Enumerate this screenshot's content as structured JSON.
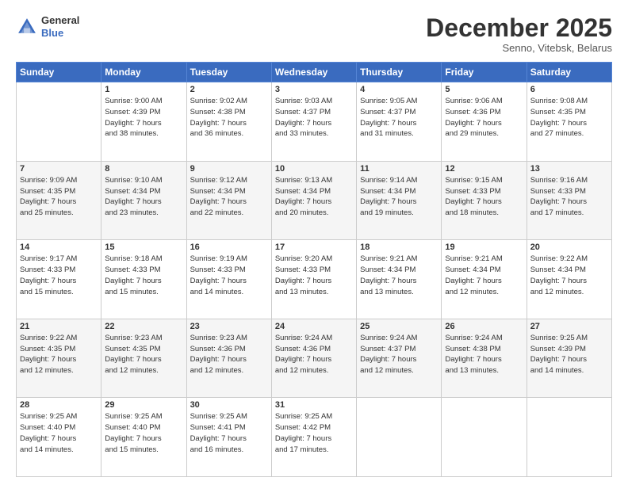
{
  "header": {
    "logo_line1": "General",
    "logo_line2": "Blue",
    "month_title": "December 2025",
    "location": "Senno, Vitebsk, Belarus"
  },
  "days_of_week": [
    "Sunday",
    "Monday",
    "Tuesday",
    "Wednesday",
    "Thursday",
    "Friday",
    "Saturday"
  ],
  "weeks": [
    [
      {
        "day": "",
        "info": ""
      },
      {
        "day": "1",
        "info": "Sunrise: 9:00 AM\nSunset: 4:39 PM\nDaylight: 7 hours\nand 38 minutes."
      },
      {
        "day": "2",
        "info": "Sunrise: 9:02 AM\nSunset: 4:38 PM\nDaylight: 7 hours\nand 36 minutes."
      },
      {
        "day": "3",
        "info": "Sunrise: 9:03 AM\nSunset: 4:37 PM\nDaylight: 7 hours\nand 33 minutes."
      },
      {
        "day": "4",
        "info": "Sunrise: 9:05 AM\nSunset: 4:37 PM\nDaylight: 7 hours\nand 31 minutes."
      },
      {
        "day": "5",
        "info": "Sunrise: 9:06 AM\nSunset: 4:36 PM\nDaylight: 7 hours\nand 29 minutes."
      },
      {
        "day": "6",
        "info": "Sunrise: 9:08 AM\nSunset: 4:35 PM\nDaylight: 7 hours\nand 27 minutes."
      }
    ],
    [
      {
        "day": "7",
        "info": "Sunrise: 9:09 AM\nSunset: 4:35 PM\nDaylight: 7 hours\nand 25 minutes."
      },
      {
        "day": "8",
        "info": "Sunrise: 9:10 AM\nSunset: 4:34 PM\nDaylight: 7 hours\nand 23 minutes."
      },
      {
        "day": "9",
        "info": "Sunrise: 9:12 AM\nSunset: 4:34 PM\nDaylight: 7 hours\nand 22 minutes."
      },
      {
        "day": "10",
        "info": "Sunrise: 9:13 AM\nSunset: 4:34 PM\nDaylight: 7 hours\nand 20 minutes."
      },
      {
        "day": "11",
        "info": "Sunrise: 9:14 AM\nSunset: 4:34 PM\nDaylight: 7 hours\nand 19 minutes."
      },
      {
        "day": "12",
        "info": "Sunrise: 9:15 AM\nSunset: 4:33 PM\nDaylight: 7 hours\nand 18 minutes."
      },
      {
        "day": "13",
        "info": "Sunrise: 9:16 AM\nSunset: 4:33 PM\nDaylight: 7 hours\nand 17 minutes."
      }
    ],
    [
      {
        "day": "14",
        "info": "Sunrise: 9:17 AM\nSunset: 4:33 PM\nDaylight: 7 hours\nand 15 minutes."
      },
      {
        "day": "15",
        "info": "Sunrise: 9:18 AM\nSunset: 4:33 PM\nDaylight: 7 hours\nand 15 minutes."
      },
      {
        "day": "16",
        "info": "Sunrise: 9:19 AM\nSunset: 4:33 PM\nDaylight: 7 hours\nand 14 minutes."
      },
      {
        "day": "17",
        "info": "Sunrise: 9:20 AM\nSunset: 4:33 PM\nDaylight: 7 hours\nand 13 minutes."
      },
      {
        "day": "18",
        "info": "Sunrise: 9:21 AM\nSunset: 4:34 PM\nDaylight: 7 hours\nand 13 minutes."
      },
      {
        "day": "19",
        "info": "Sunrise: 9:21 AM\nSunset: 4:34 PM\nDaylight: 7 hours\nand 12 minutes."
      },
      {
        "day": "20",
        "info": "Sunrise: 9:22 AM\nSunset: 4:34 PM\nDaylight: 7 hours\nand 12 minutes."
      }
    ],
    [
      {
        "day": "21",
        "info": "Sunrise: 9:22 AM\nSunset: 4:35 PM\nDaylight: 7 hours\nand 12 minutes."
      },
      {
        "day": "22",
        "info": "Sunrise: 9:23 AM\nSunset: 4:35 PM\nDaylight: 7 hours\nand 12 minutes."
      },
      {
        "day": "23",
        "info": "Sunrise: 9:23 AM\nSunset: 4:36 PM\nDaylight: 7 hours\nand 12 minutes."
      },
      {
        "day": "24",
        "info": "Sunrise: 9:24 AM\nSunset: 4:36 PM\nDaylight: 7 hours\nand 12 minutes."
      },
      {
        "day": "25",
        "info": "Sunrise: 9:24 AM\nSunset: 4:37 PM\nDaylight: 7 hours\nand 12 minutes."
      },
      {
        "day": "26",
        "info": "Sunrise: 9:24 AM\nSunset: 4:38 PM\nDaylight: 7 hours\nand 13 minutes."
      },
      {
        "day": "27",
        "info": "Sunrise: 9:25 AM\nSunset: 4:39 PM\nDaylight: 7 hours\nand 14 minutes."
      }
    ],
    [
      {
        "day": "28",
        "info": "Sunrise: 9:25 AM\nSunset: 4:40 PM\nDaylight: 7 hours\nand 14 minutes."
      },
      {
        "day": "29",
        "info": "Sunrise: 9:25 AM\nSunset: 4:40 PM\nDaylight: 7 hours\nand 15 minutes."
      },
      {
        "day": "30",
        "info": "Sunrise: 9:25 AM\nSunset: 4:41 PM\nDaylight: 7 hours\nand 16 minutes."
      },
      {
        "day": "31",
        "info": "Sunrise: 9:25 AM\nSunset: 4:42 PM\nDaylight: 7 hours\nand 17 minutes."
      },
      {
        "day": "",
        "info": ""
      },
      {
        "day": "",
        "info": ""
      },
      {
        "day": "",
        "info": ""
      }
    ]
  ]
}
